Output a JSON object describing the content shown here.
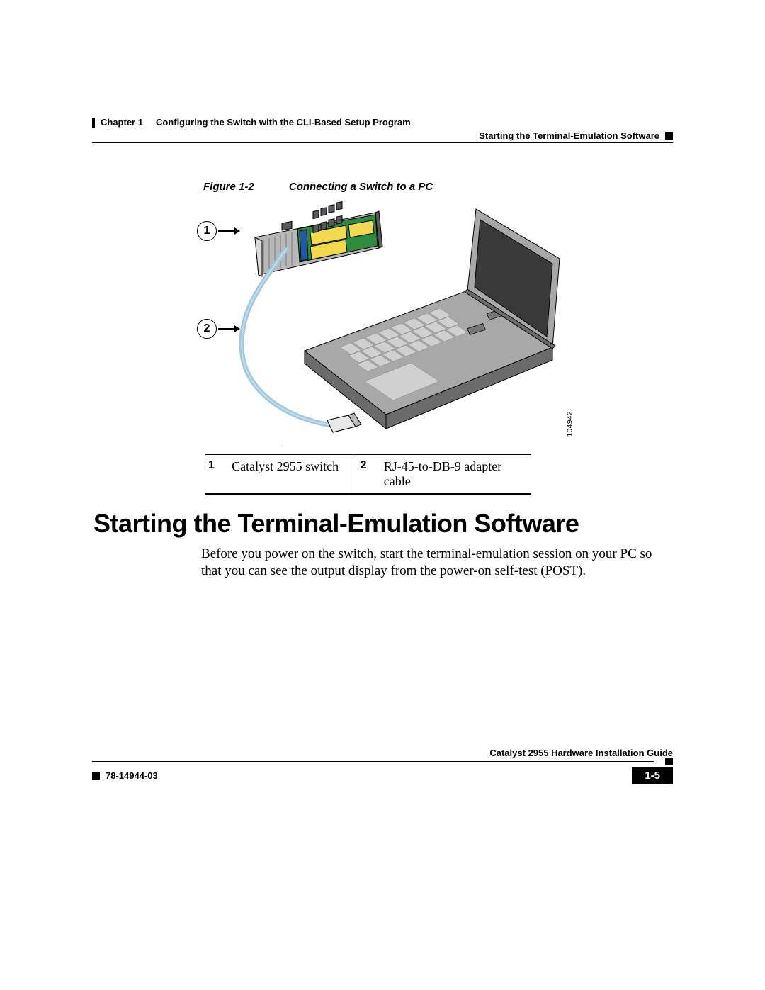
{
  "header": {
    "chapter_label": "Chapter 1",
    "chapter_title": "Configuring the Switch with the CLI-Based Setup Program",
    "section_title": "Starting the Terminal-Emulation Software"
  },
  "figure": {
    "label": "Figure 1-2",
    "title": "Connecting a Switch to a PC",
    "callouts": {
      "one": "1",
      "two": "2"
    },
    "image_number": "104942"
  },
  "legend": {
    "row": {
      "num1": "1",
      "text1": "Catalyst 2955 switch",
      "num2": "2",
      "text2": "RJ-45-to-DB-9 adapter cable"
    }
  },
  "heading": "Starting the Terminal-Emulation Software",
  "body": "Before you power on the switch, start the terminal-emulation session on your PC so that you can see the output display from the power-on self-test (POST).",
  "footer": {
    "guide_title": "Catalyst 2955 Hardware Installation Guide",
    "doc_number": "78-14944-03",
    "page_number": "1-5"
  }
}
